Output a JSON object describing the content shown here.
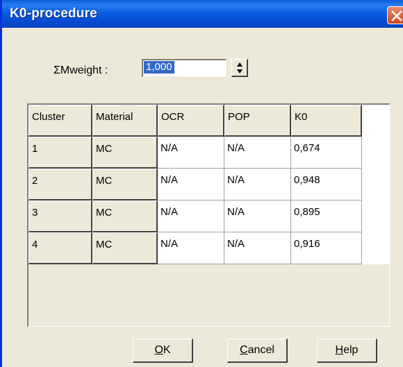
{
  "window": {
    "title": "K0-procedure"
  },
  "mweight": {
    "label": "ΣMweight :",
    "value": "1,000"
  },
  "table": {
    "headers": [
      "Cluster",
      "Material",
      "OCR",
      "POP",
      "K0"
    ],
    "rows": [
      [
        "1",
        "MC",
        "N/A",
        "N/A",
        "0,674"
      ],
      [
        "2",
        "MC",
        "N/A",
        "N/A",
        "0,948"
      ],
      [
        "3",
        "MC",
        "N/A",
        "N/A",
        "0,895"
      ],
      [
        "4",
        "MC",
        "N/A",
        "N/A",
        "0,916"
      ]
    ]
  },
  "buttons": {
    "ok": "OK",
    "cancel": "Cancel",
    "help": "Help"
  },
  "icons": {
    "close": "close-icon",
    "spin": "spin-arrows-icon"
  }
}
